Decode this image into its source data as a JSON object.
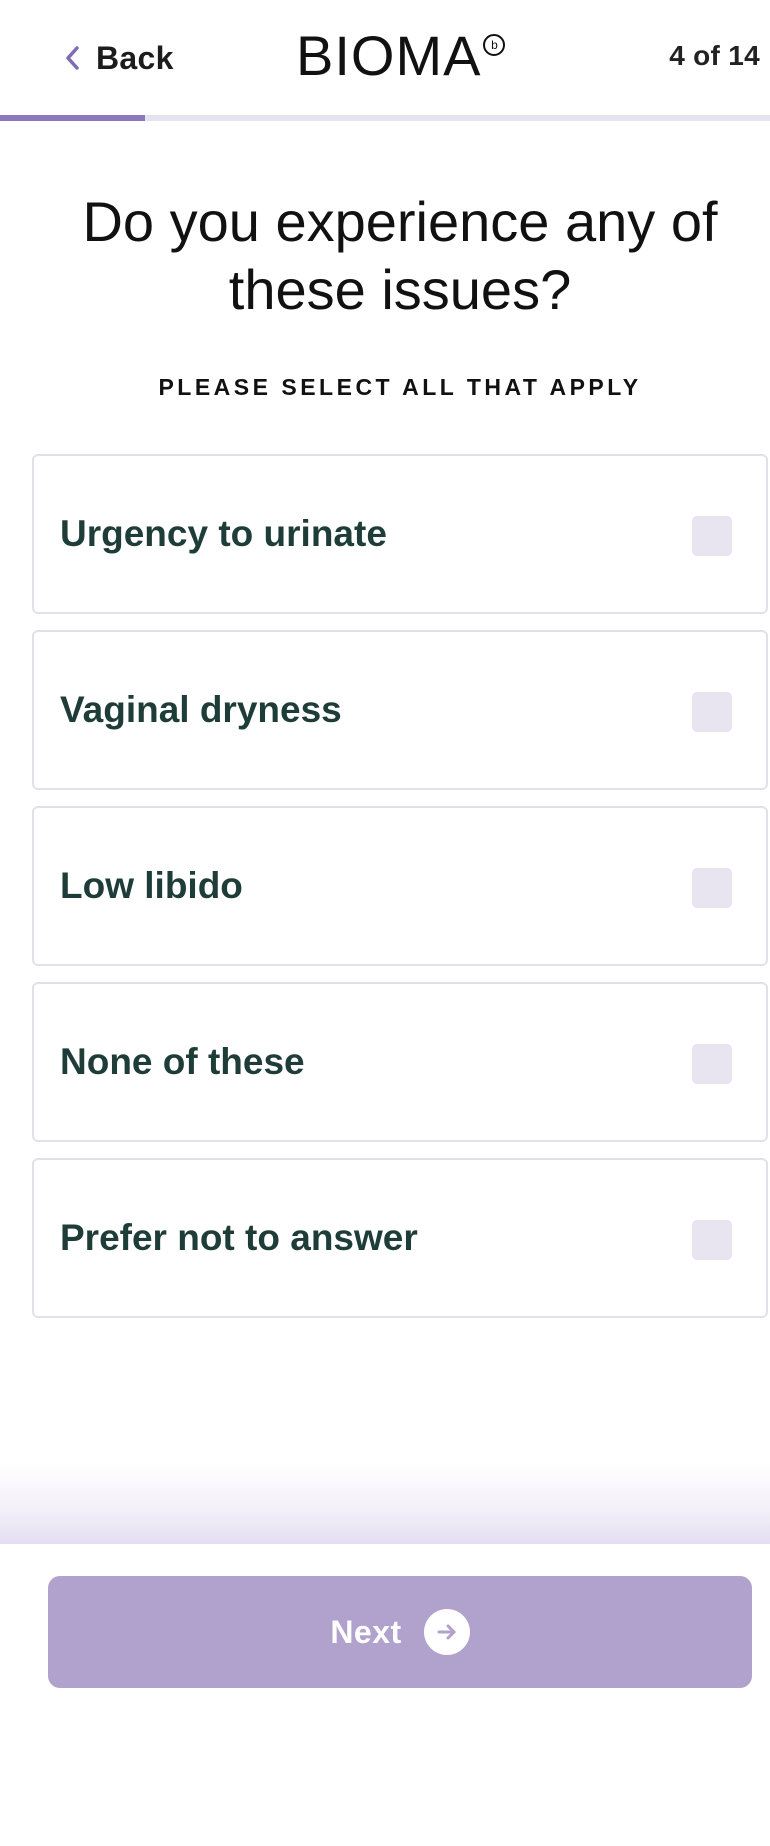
{
  "header": {
    "back_label": "Back",
    "logo_text": "BIOMA",
    "logo_mark": "b",
    "step_counter": "4 of 14",
    "progress_fraction": 0.1887
  },
  "question": {
    "title": "Do you experience any of these issues?",
    "instruction": "PLEASE SELECT ALL THAT APPLY"
  },
  "options": [
    {
      "label": "Urgency to urinate",
      "checked": false
    },
    {
      "label": "Vaginal dryness",
      "checked": false
    },
    {
      "label": "Low libido",
      "checked": false
    },
    {
      "label": "None of these",
      "checked": false
    },
    {
      "label": "Prefer not to answer",
      "checked": false
    }
  ],
  "footer": {
    "next_label": "Next",
    "next_disabled": true
  },
  "colors": {
    "accent": "#8b78bf",
    "button_disabled": "#b0a2cc",
    "option_text": "#1f3d38",
    "checkbox_bg": "#e8e5f1"
  },
  "icons": {
    "back": "chevron-left-icon",
    "next": "arrow-right-circle-icon"
  }
}
